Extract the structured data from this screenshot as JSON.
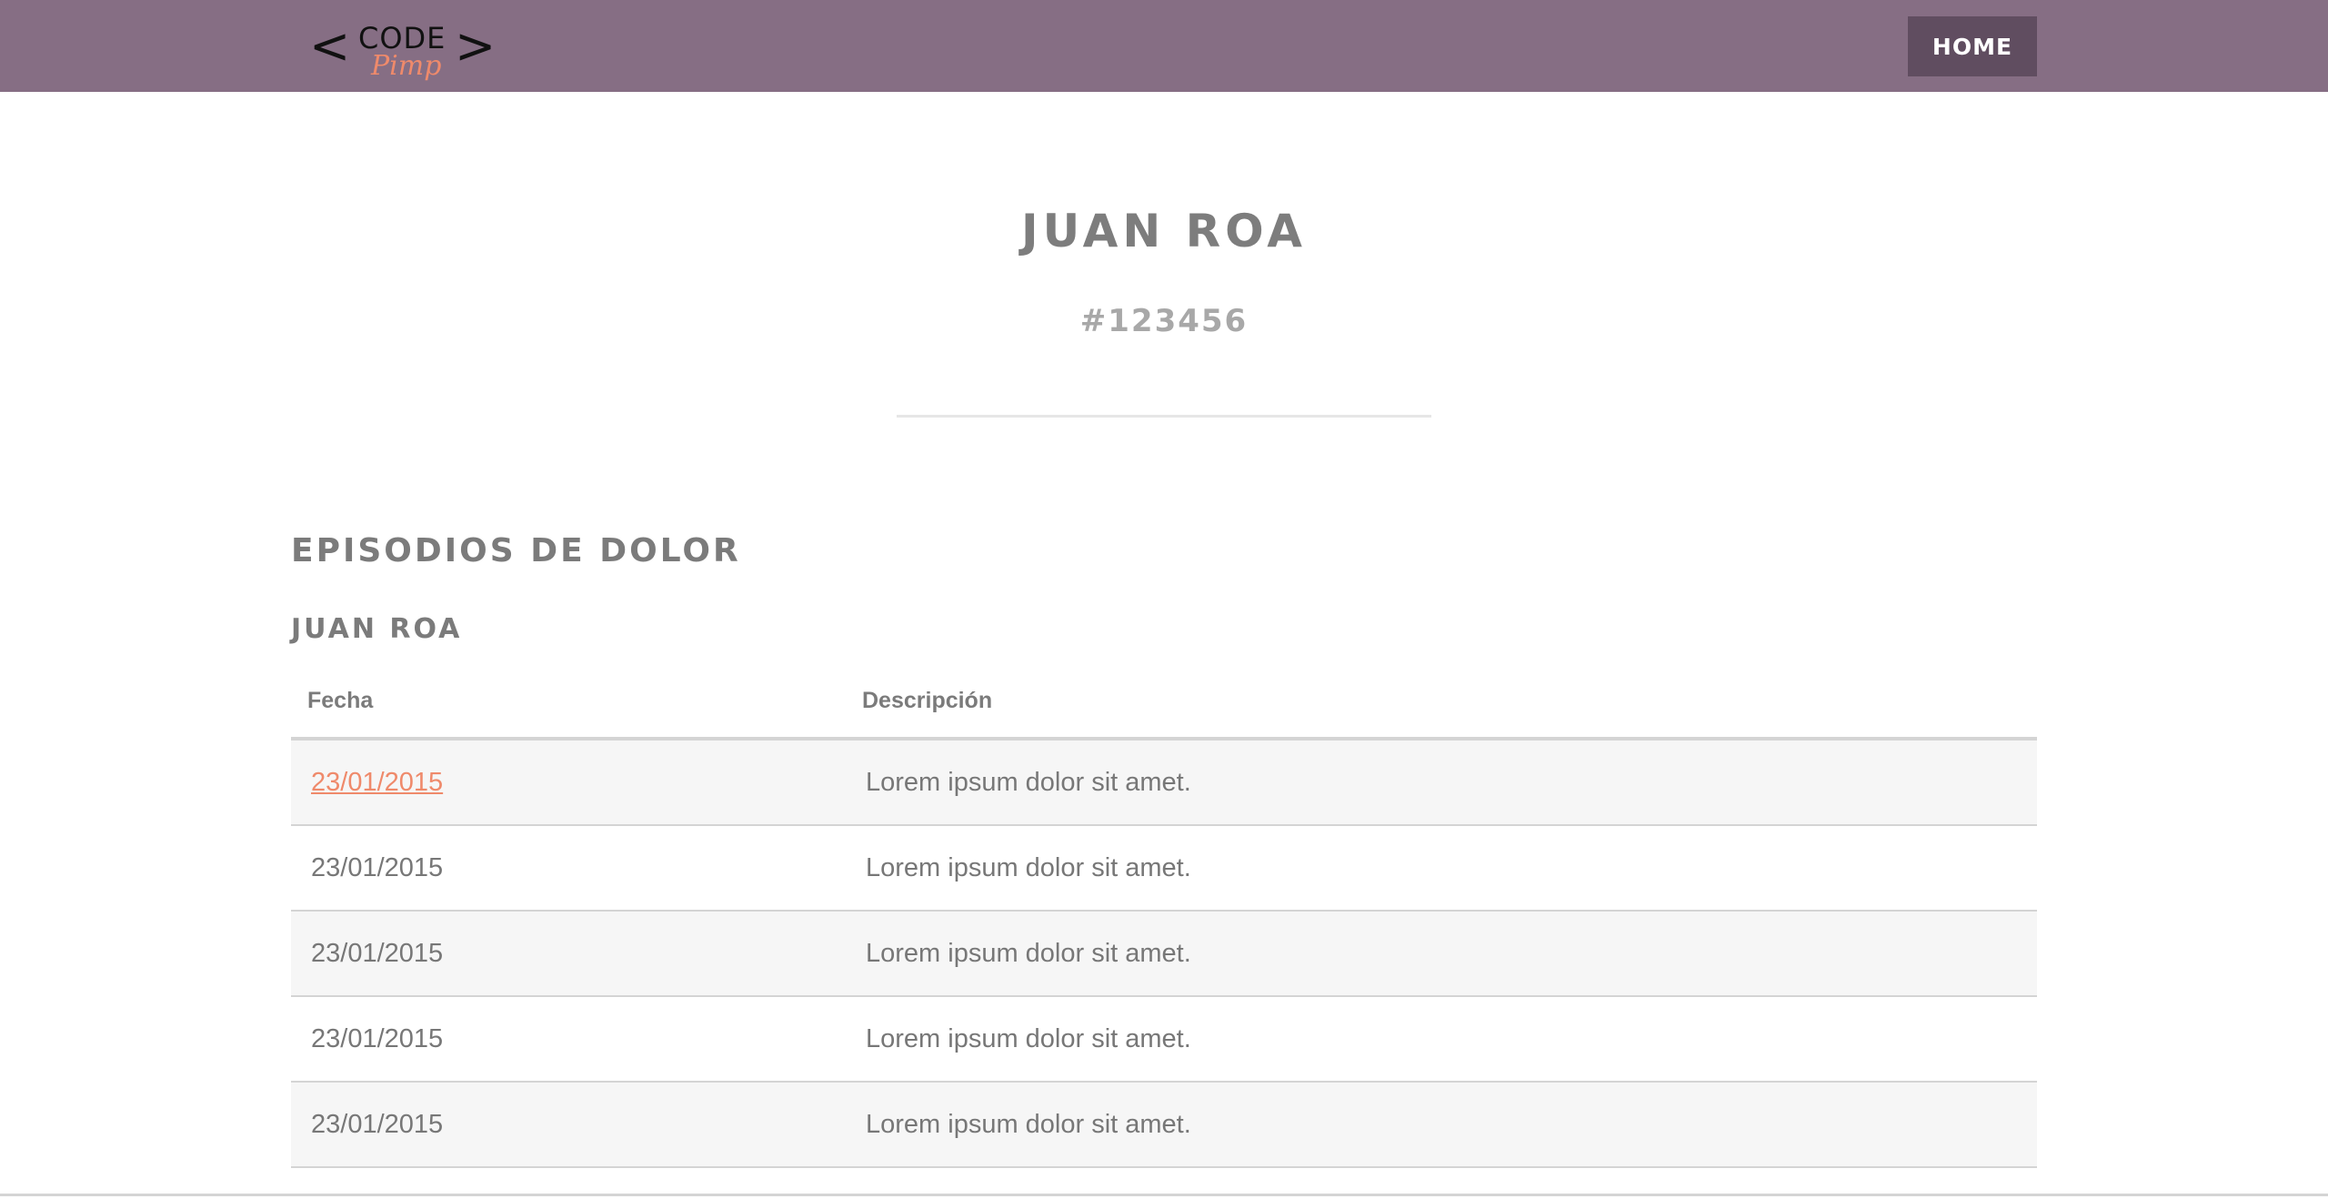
{
  "header": {
    "logo": {
      "left_bracket": "<",
      "code": "CODE",
      "pimp": "Pimp",
      "right_bracket": ">"
    },
    "home_label": "HOME",
    "colors": {
      "navbar_bg": "#866e84",
      "home_bg": "#604d60",
      "accent": "#ef8a6b"
    }
  },
  "patient": {
    "name": "JUAN ROA",
    "id": "#123456"
  },
  "section": {
    "title": "EPISODIOS DE DOLOR",
    "subtitle": "JUAN ROA"
  },
  "table": {
    "headers": {
      "date": "Fecha",
      "description": "Descripción"
    },
    "rows": [
      {
        "date": "23/01/2015",
        "description": "Lorem ipsum dolor sit amet."
      },
      {
        "date": "23/01/2015",
        "description": "Lorem ipsum dolor sit amet."
      },
      {
        "date": "23/01/2015",
        "description": "Lorem ipsum dolor sit amet."
      },
      {
        "date": "23/01/2015",
        "description": "Lorem ipsum dolor sit amet."
      },
      {
        "date": "23/01/2015",
        "description": "Lorem ipsum dolor sit amet."
      }
    ]
  }
}
